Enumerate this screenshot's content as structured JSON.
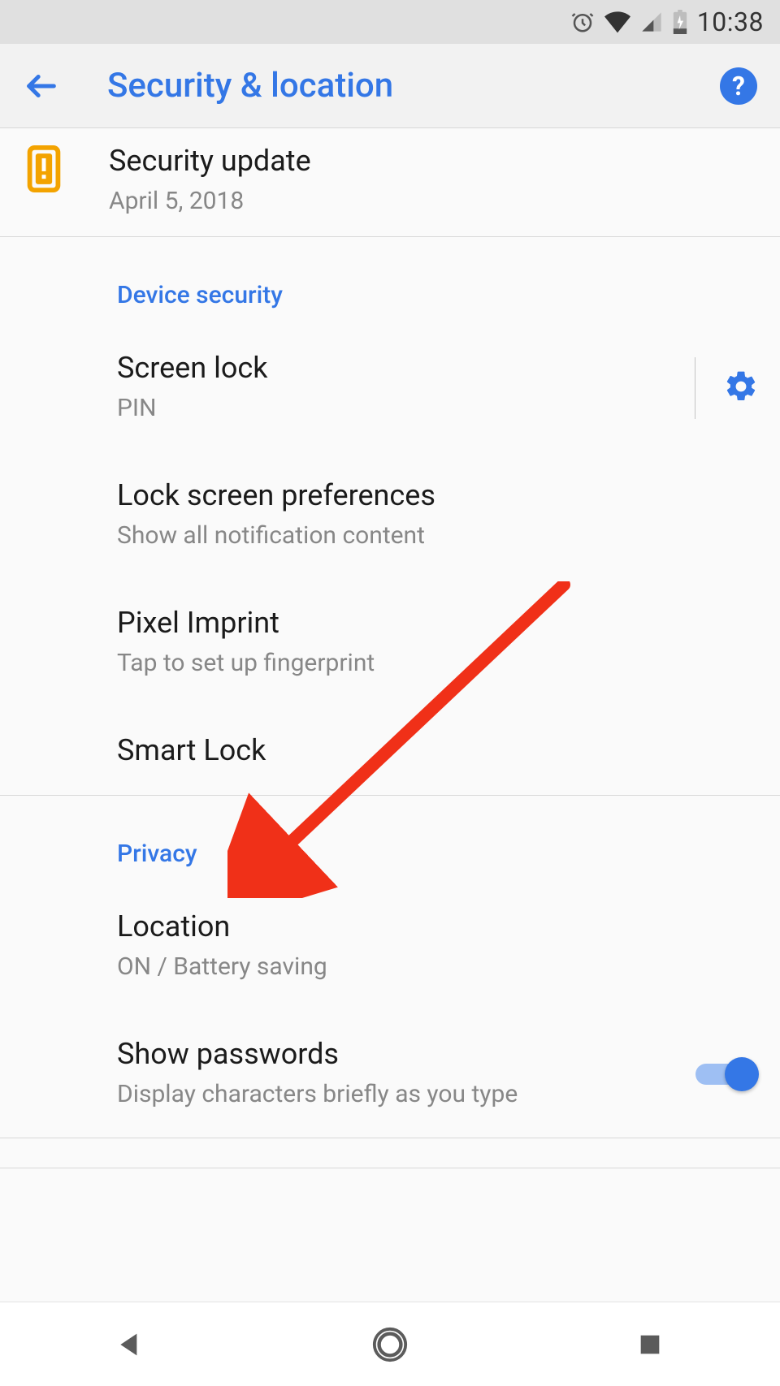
{
  "status_bar": {
    "time": "10:38"
  },
  "app_bar": {
    "title": "Security & location"
  },
  "security_update": {
    "title": "Security update",
    "subtitle": "April 5, 2018"
  },
  "sections": {
    "device_security": {
      "header": "Device security",
      "screen_lock": {
        "title": "Screen lock",
        "subtitle": "PIN"
      },
      "lock_screen_prefs": {
        "title": "Lock screen preferences",
        "subtitle": "Show all notification content"
      },
      "pixel_imprint": {
        "title": "Pixel Imprint",
        "subtitle": "Tap to set up fingerprint"
      },
      "smart_lock": {
        "title": "Smart Lock"
      }
    },
    "privacy": {
      "header": "Privacy",
      "location": {
        "title": "Location",
        "subtitle": "ON / Battery saving"
      },
      "show_passwords": {
        "title": "Show passwords",
        "subtitle": "Display characters briefly as you type",
        "toggle": true
      }
    }
  },
  "colors": {
    "accent": "#3477e6",
    "warning": "#f3a300",
    "annotation_arrow": "#f03018"
  }
}
